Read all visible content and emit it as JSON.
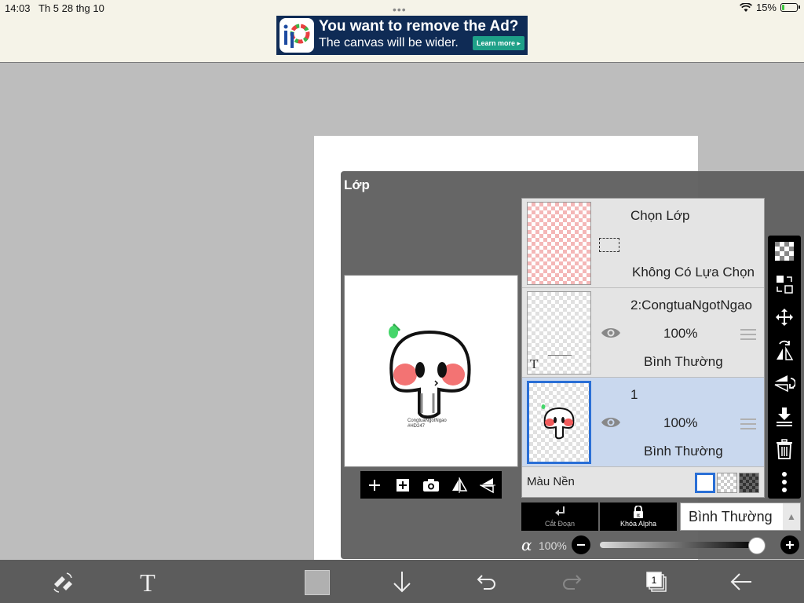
{
  "status_bar": {
    "time": "14:03",
    "date": "Th 5 28 thg 10",
    "battery": "15%",
    "battery_level": 0.15
  },
  "ad": {
    "title": "You want to remove the Ad?",
    "subtitle": "The canvas will be wider.",
    "button": "Learn more ▸"
  },
  "layer_panel": {
    "title": "Lớp",
    "selection_layer": {
      "name": "Chọn Lớp",
      "status": "Không Có Lựa Chọn"
    },
    "layers": [
      {
        "name": "2:CongtuaNgotNgao",
        "opacity": "100%",
        "blend": "Bình Thường",
        "is_text": true,
        "selected": false
      },
      {
        "name": "1",
        "opacity": "100%",
        "blend": "Bình Thường",
        "is_text": false,
        "selected": true
      }
    ],
    "background": {
      "label": "Màu Nền",
      "options": [
        "white",
        "transparent",
        "dark-checker"
      ],
      "selected": "white"
    },
    "actions": {
      "clipping": "Cắt Đoạn",
      "alpha_lock": "Khóa Alpha",
      "blend_mode": "Bình Thường"
    },
    "alpha": {
      "symbol": "α",
      "value": "100%",
      "level": 1.0
    },
    "preview_caption": "CongtuaNgotNgao #HD247"
  },
  "colors": {
    "accent": "#2a6fd6",
    "selected_row": "#c9d8ee",
    "current_color": "#b0b0b0"
  },
  "bottom_toolbar": {
    "layer_count": "1"
  }
}
